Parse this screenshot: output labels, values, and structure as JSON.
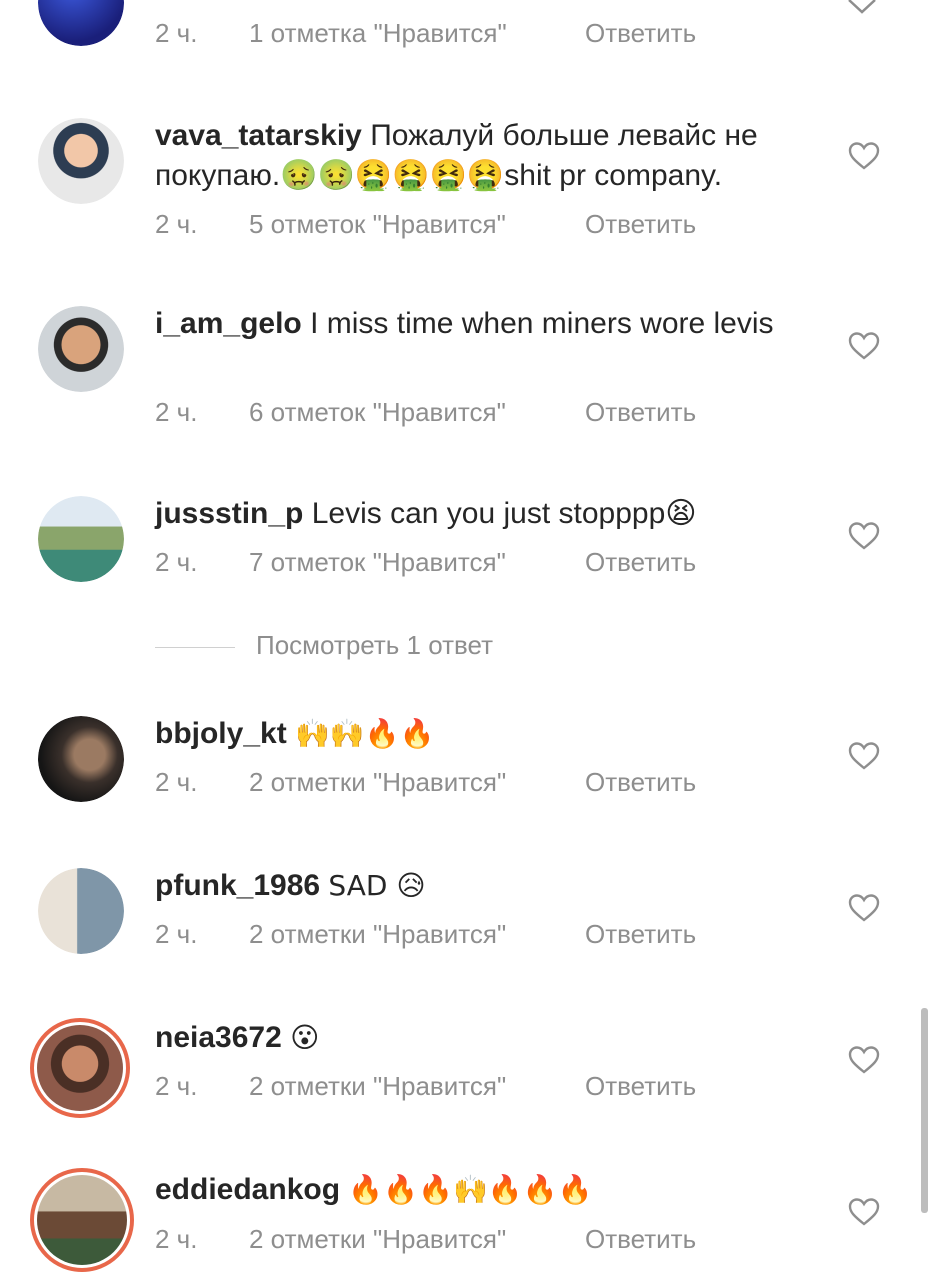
{
  "top_partial": {
    "time": "2 ч.",
    "likes": "1 отметка \"Нравится\"",
    "reply": "Ответить"
  },
  "comments": [
    {
      "username": "vava_tatarskiy",
      "text": "Пожалуй больше левайс не покупаю.🤢🤢🤮🤮🤮🤮shit pr company.",
      "time": "2 ч.",
      "likes": "5 отметок \"Нравится\"",
      "reply": "Ответить"
    },
    {
      "username": "i_am_gelo",
      "text": "I miss time when miners wore levis",
      "time": "2 ч.",
      "likes": "6 отметок \"Нравится\"",
      "reply": "Ответить"
    },
    {
      "username": "jussstin_p",
      "text": "Levis can you just stopppp😫",
      "time": "2 ч.",
      "likes": "7 отметок \"Нравится\"",
      "reply": "Ответить"
    },
    {
      "username": "bbjoly_kt",
      "text": "🙌🙌🔥🔥",
      "time": "2 ч.",
      "likes": "2 отметки \"Нравится\"",
      "reply": "Ответить"
    },
    {
      "username": "pfunk_1986",
      "text": "SAD 😥",
      "time": "2 ч.",
      "likes": "2 отметки \"Нравится\"",
      "reply": "Ответить"
    },
    {
      "username": "neia3672",
      "text": "😮",
      "time": "2 ч.",
      "likes": "2 отметки \"Нравится\"",
      "reply": "Ответить"
    },
    {
      "username": "eddiedankog",
      "text": "🔥🔥🔥🙌🔥🔥🔥",
      "time": "2 ч.",
      "likes": "2 отметки \"Нравится\"",
      "reply": "Ответить"
    }
  ],
  "view_replies": "Посмотреть 1 ответ",
  "icons": {
    "like": "heart-outline-icon",
    "collapse": "chevron-down-icon"
  },
  "colors": {
    "text": "#262626",
    "secondary": "#8e8e8e",
    "story_ring": "#e8674a"
  }
}
